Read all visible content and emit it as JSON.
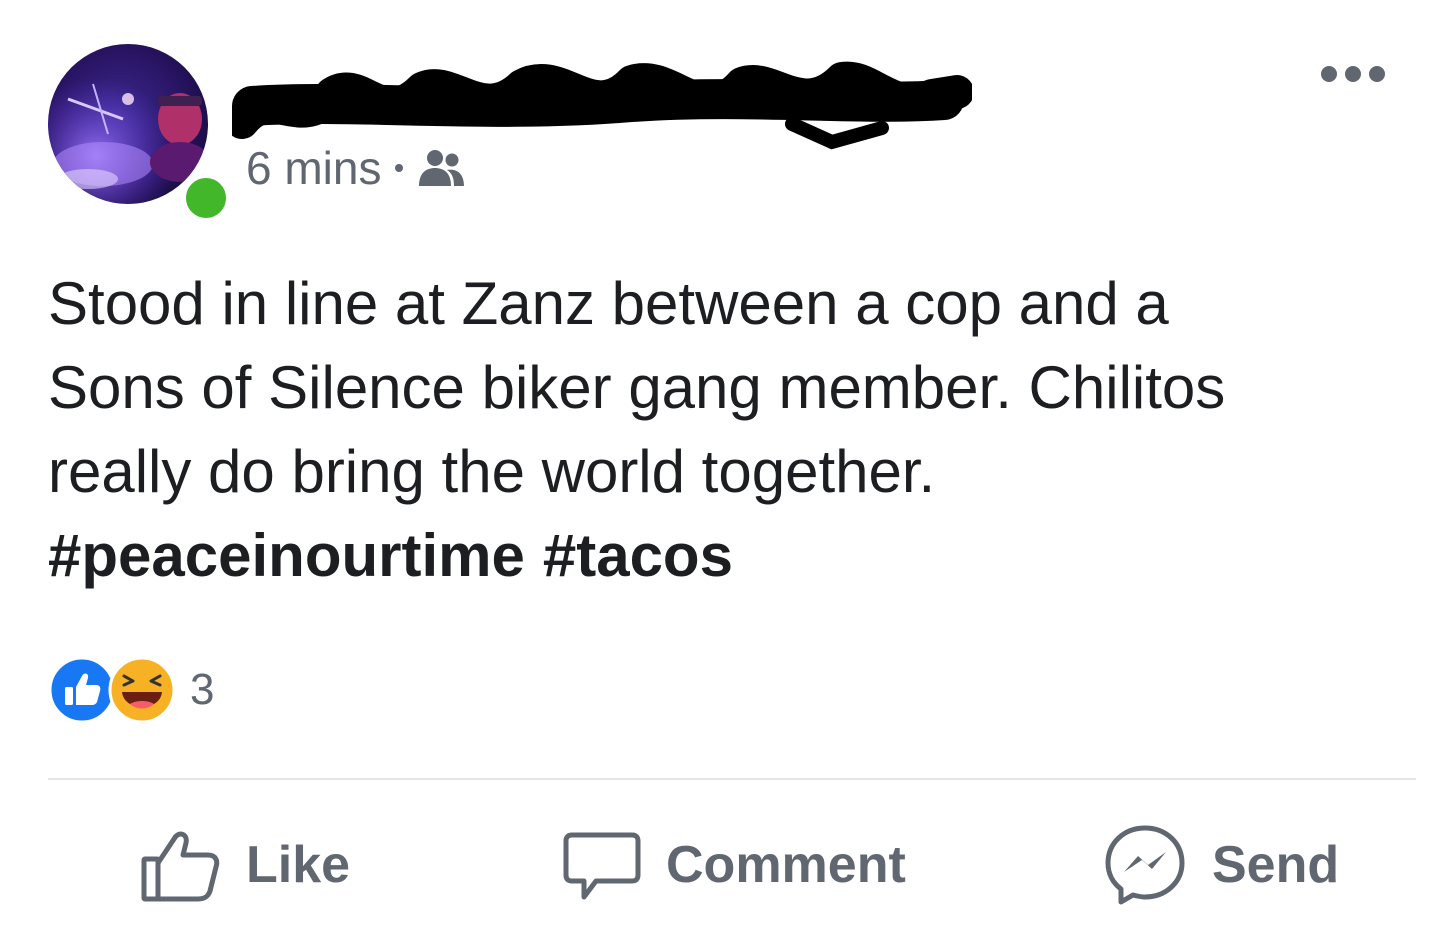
{
  "post": {
    "author": {
      "name_redacted": true
    },
    "timestamp": "6 mins",
    "audience_icon": "friends-icon",
    "more_icon": "more-options-icon",
    "text_lines": [
      "Stood in line at Zanz between a cop and a",
      "Sons of Silence biker gang member. Chilitos",
      "really do bring the world together."
    ],
    "hashtags": [
      "#peaceinourtime",
      "#tacos"
    ],
    "reactions": {
      "icons": [
        "like-reaction-icon",
        "haha-reaction-icon"
      ],
      "count": "3"
    },
    "actions": {
      "like_label": "Like",
      "comment_label": "Comment",
      "send_label": "Send"
    }
  },
  "colors": {
    "text_primary": "#1c1e21",
    "text_secondary": "#606770",
    "online": "#42b72a",
    "like_blue": "#1877f2",
    "haha_yellow": "#f7b125",
    "divider": "#e4e6eb"
  }
}
